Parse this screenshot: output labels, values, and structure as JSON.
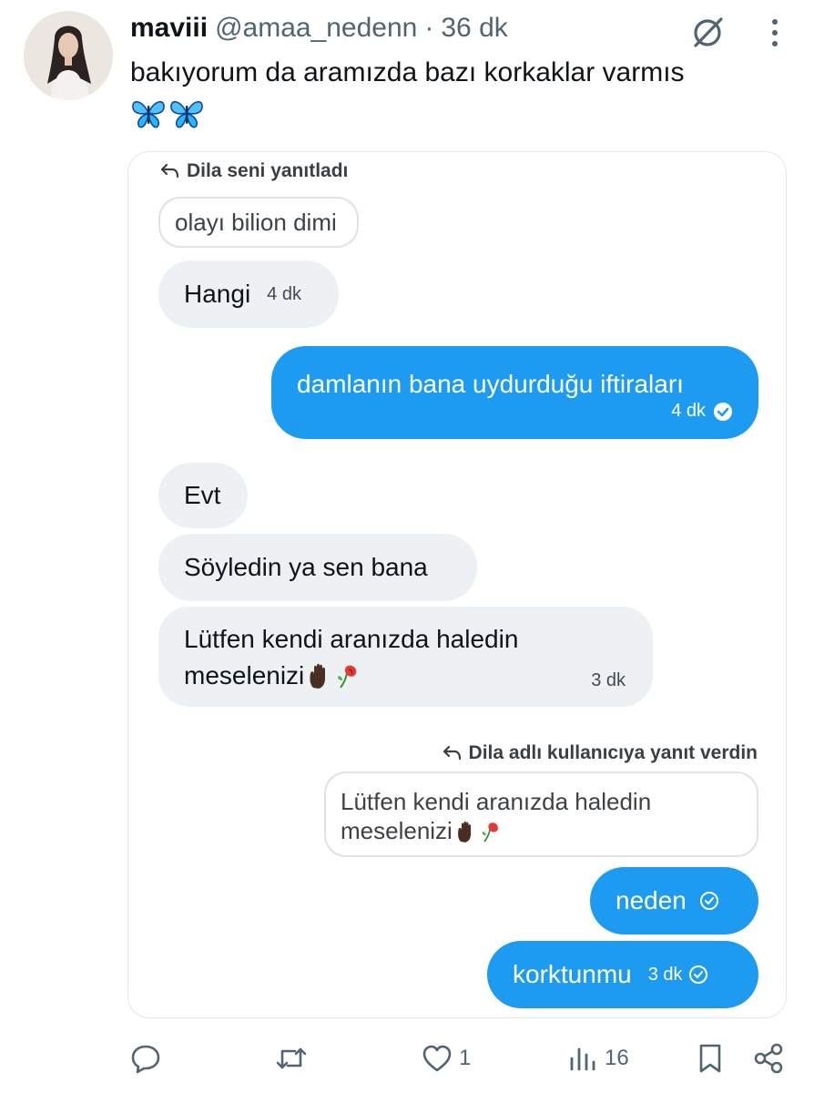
{
  "tweet": {
    "display_name": "maviii",
    "handle": "@amaa_nedenn",
    "separator": "·",
    "time": "36 dk",
    "text": "bakıyorum da aramızda bazı korkaklar varmıs",
    "emoji_icons": [
      "butterfly-emoji",
      "butterfly-emoji"
    ]
  },
  "chat": {
    "reply_meta_1": "Dila seni yanıtladı",
    "quote_1": "olayı bilion dimi",
    "messages": [
      {
        "side": "in",
        "text": "Hangi",
        "time": "4 dk"
      },
      {
        "side": "out",
        "text": "damlanın bana uydurduğu iftiraları",
        "time": "4 dk"
      },
      {
        "side": "in",
        "text": "Evt"
      },
      {
        "side": "in",
        "text": "Söyledin ya sen bana"
      },
      {
        "side": "in",
        "text_line1": "Lütfen kendi aranızda haledin",
        "text_line2": "meselenizi",
        "time": "3 dk"
      },
      {
        "side": "out",
        "text": "neden"
      },
      {
        "side": "out",
        "text": "korktunmu",
        "time": "3 dk"
      }
    ],
    "reply_meta_2": "Dila adlı kullanıcıya yanıt verdin",
    "quote_2_line1": "Lütfen kendi aranızda haledin",
    "quote_2_line2": "meselenizi"
  },
  "actions": {
    "reply_count": "",
    "retweet_count": "",
    "like_count": "1",
    "views_count": "16"
  },
  "colors": {
    "accent": "#1d9bf0",
    "incoming_bubble": "#eef1f3",
    "muted_text": "#536471"
  }
}
